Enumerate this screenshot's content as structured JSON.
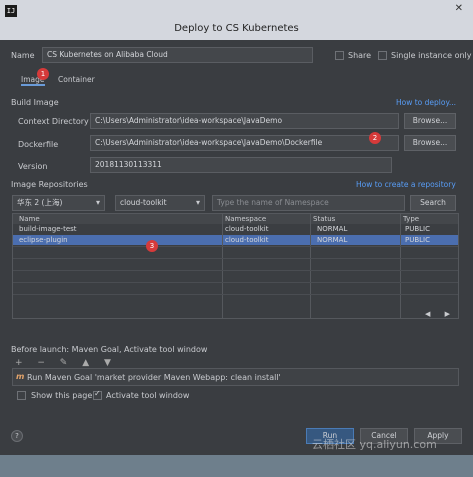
{
  "window": {
    "app_icon": "IJ",
    "title": "Deploy to CS Kubernetes",
    "close": "✕"
  },
  "name_row": {
    "label": "Name",
    "value": "CS Kubernetes on Alibaba Cloud",
    "share_label": "Share",
    "single_instance_label": "Single instance only"
  },
  "tabs": [
    {
      "label": "Image"
    },
    {
      "label": "Container"
    }
  ],
  "build_image": {
    "section": "Build Image",
    "how_to_deploy": "How to deploy...",
    "context_label": "Context Directory",
    "context_value": "C:\\Users\\Administrator\\idea-workspace\\JavaDemo",
    "dockerfile_label": "Dockerfile",
    "dockerfile_value": "C:\\Users\\Administrator\\idea-workspace\\JavaDemo\\Dockerfile",
    "version_label": "Version",
    "version_value": "20181130113311",
    "browse_label": "Browse..."
  },
  "repositories": {
    "section": "Image  Repositories",
    "create_link": "How to create a repository",
    "region": "华东 2 (上海)",
    "namespace": "cloud-toolkit",
    "search_placeholder": "Type the name of Namespace",
    "search_button": "Search",
    "columns": [
      "Name",
      "Namespace",
      "Status",
      "Type"
    ],
    "rows": [
      {
        "name": "build-image-test",
        "namespace": "cloud-toolkit",
        "status": "NORMAL",
        "type": "PUBLIC"
      },
      {
        "name": "eclipse-plugin",
        "namespace": "cloud-toolkit",
        "status": "NORMAL",
        "type": "PUBLIC"
      }
    ],
    "pager": "◀ ▶"
  },
  "before_launch": {
    "label": "Before launch: Maven Goal, Activate tool window",
    "toolbar": "+ − ✎ ▲ ▼",
    "task": "Run Maven Goal 'market provider Maven Webapp: clean install'",
    "show_page": "Show this page",
    "activate_tool": "Activate tool window"
  },
  "badges": [
    "1",
    "2",
    "3"
  ],
  "buttons": {
    "run": "Run",
    "cancel": "Cancel",
    "apply": "Apply",
    "help": "?"
  },
  "watermark": "云栖社区 yq.aliyun.com"
}
